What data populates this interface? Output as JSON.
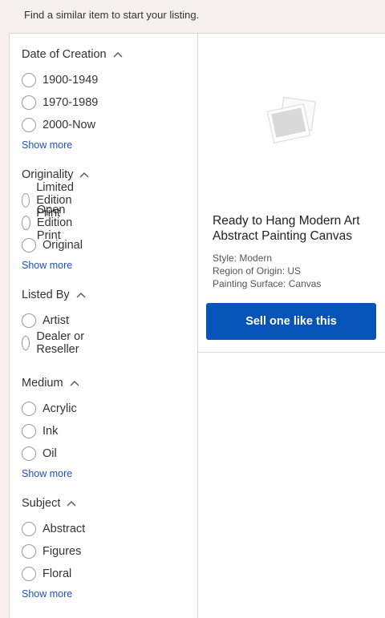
{
  "header": {
    "message": "Find a similar item to start your listing."
  },
  "sidebar": {
    "facets": [
      {
        "title": "Date of Creation",
        "options": [
          "1900-1949",
          "1970-1989",
          "2000-Now"
        ],
        "show_more": "Show more"
      },
      {
        "title": "Originality",
        "options": [
          "Limited Edition Print",
          "Open Edition Print",
          "Original"
        ],
        "show_more": "Show more"
      },
      {
        "title": "Listed By",
        "options": [
          "Artist",
          "Dealer or Reseller"
        ]
      },
      {
        "title": "Medium",
        "options": [
          "Acrylic",
          "Ink",
          "Oil"
        ],
        "show_more": "Show more"
      },
      {
        "title": "Subject",
        "options": [
          "Abstract",
          "Figures",
          "Floral"
        ],
        "show_more": "Show more"
      }
    ]
  },
  "product": {
    "title": "Ready to Hang Modern Art Abstract Painting Canvas",
    "attributes": [
      "Style: Modern",
      "Region of Origin: US",
      "Painting Surface: Canvas"
    ],
    "sell_button": "Sell one like this",
    "image_icon": "photo-placeholder-icon"
  },
  "colors": {
    "accent": "#0654ba",
    "link": "#1f4fbf",
    "background": "#f8f0f0"
  }
}
